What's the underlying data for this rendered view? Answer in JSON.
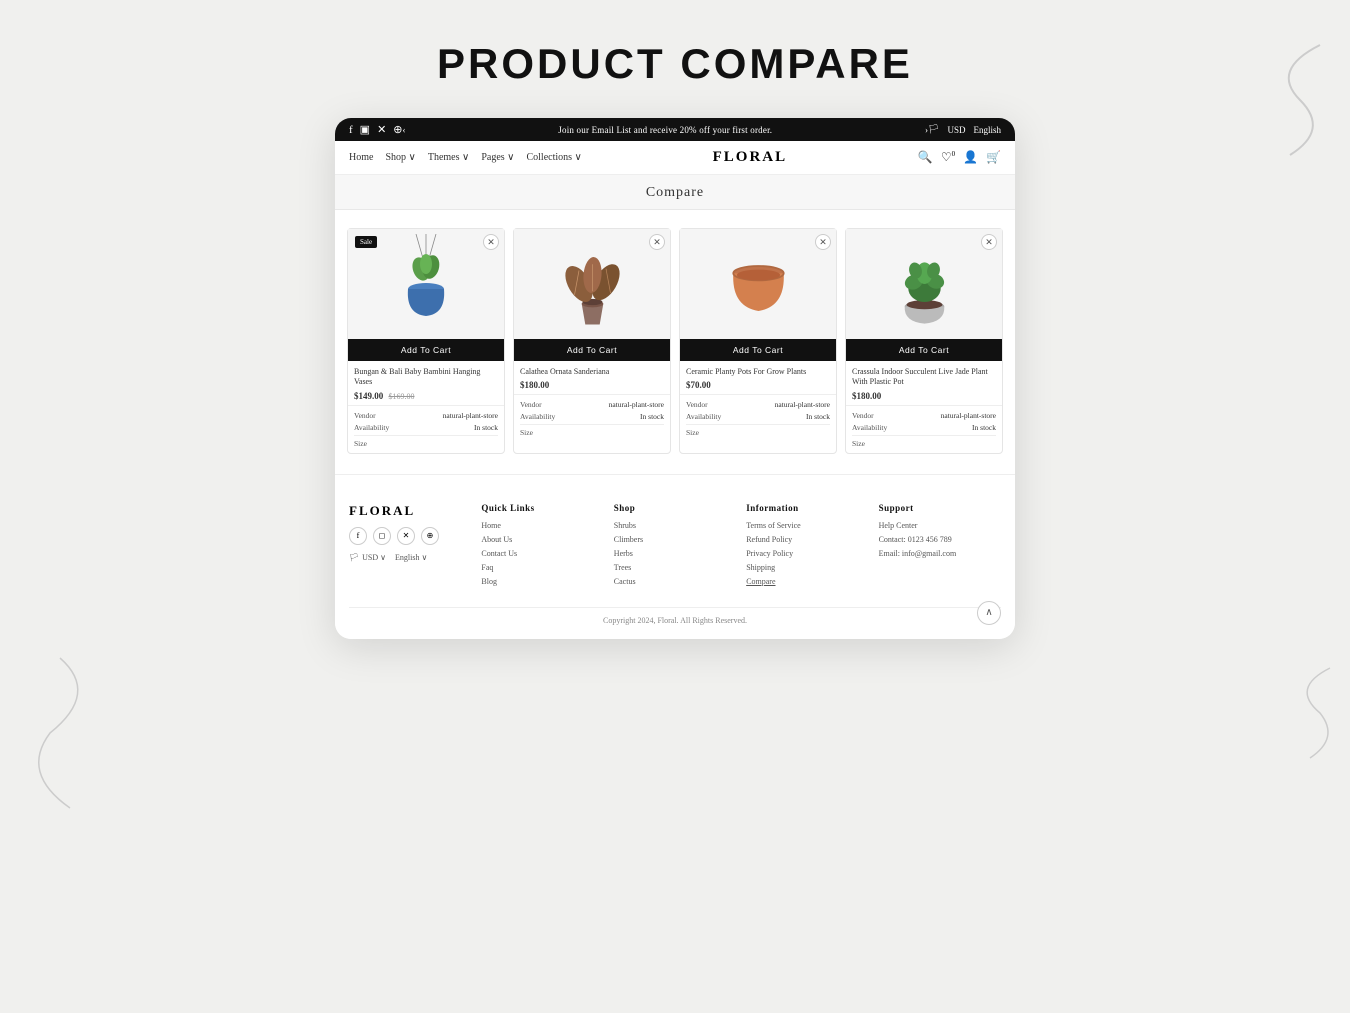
{
  "page": {
    "title": "PRODUCT COMPARE"
  },
  "topbar": {
    "social": [
      "f",
      "◻",
      "✕",
      "⊕"
    ],
    "promo": "Join our Email List and receive 20% off your first order.",
    "currency": "USD",
    "language": "English",
    "prev_arrow": "‹",
    "next_arrow": "›"
  },
  "navbar": {
    "logo": "FLORAL",
    "links": [
      {
        "label": "Home"
      },
      {
        "label": "Shop ∨"
      },
      {
        "label": "Themes ∨"
      },
      {
        "label": "Pages ∨"
      },
      {
        "label": "Collections ∨"
      }
    ]
  },
  "compare_title": "Compare",
  "products": [
    {
      "name": "Bungan & Bali Baby Bambini Hanging Vases",
      "price": "$149.00",
      "old_price": "$169.00",
      "vendor": "natural-plant-store",
      "availability": "In stock",
      "has_sale": true,
      "add_to_cart": "Add To Cart"
    },
    {
      "name": "Calathea Ornata Sanderiana",
      "price": "$180.00",
      "old_price": "",
      "vendor": "natural-plant-store",
      "availability": "In stock",
      "has_sale": false,
      "add_to_cart": "Add To Cart"
    },
    {
      "name": "Ceramic Planty Pots For Grow Plants",
      "price": "$70.00",
      "old_price": "",
      "vendor": "natural-plant-store",
      "availability": "In stock",
      "has_sale": false,
      "add_to_cart": "Add To Cart"
    },
    {
      "name": "Crassula Indoor Succulent Live Jade Plant With Plastic Pot",
      "price": "$180.00",
      "old_price": "",
      "vendor": "natural-plant-store",
      "availability": "In stock",
      "has_sale": false,
      "add_to_cart": "Add To Cart"
    }
  ],
  "meta_labels": {
    "vendor": "Vendor",
    "availability": "Availability",
    "size": "Size"
  },
  "footer": {
    "brand": "FLORAL",
    "social": [
      "f",
      "◻",
      "✕",
      "⊕"
    ],
    "currency": "USD",
    "language": "English",
    "quick_links": {
      "title": "Quick Links",
      "items": [
        "Home",
        "About Us",
        "Contact Us",
        "Faq",
        "Blog"
      ]
    },
    "shop": {
      "title": "Shop",
      "items": [
        "Shrubs",
        "Climbers",
        "Herbs",
        "Trees",
        "Cactus"
      ]
    },
    "information": {
      "title": "Information",
      "items": [
        "Terms of Service",
        "Refund Policy",
        "Privacy Policy",
        "Shipping",
        "Compare"
      ]
    },
    "support": {
      "title": "Support",
      "items": [
        "Help Center",
        "Contact: 0123 456 789",
        "Email: info@gmail.com"
      ]
    },
    "copyright": "Copyright 2024, Floral. All Rights Reserved."
  }
}
